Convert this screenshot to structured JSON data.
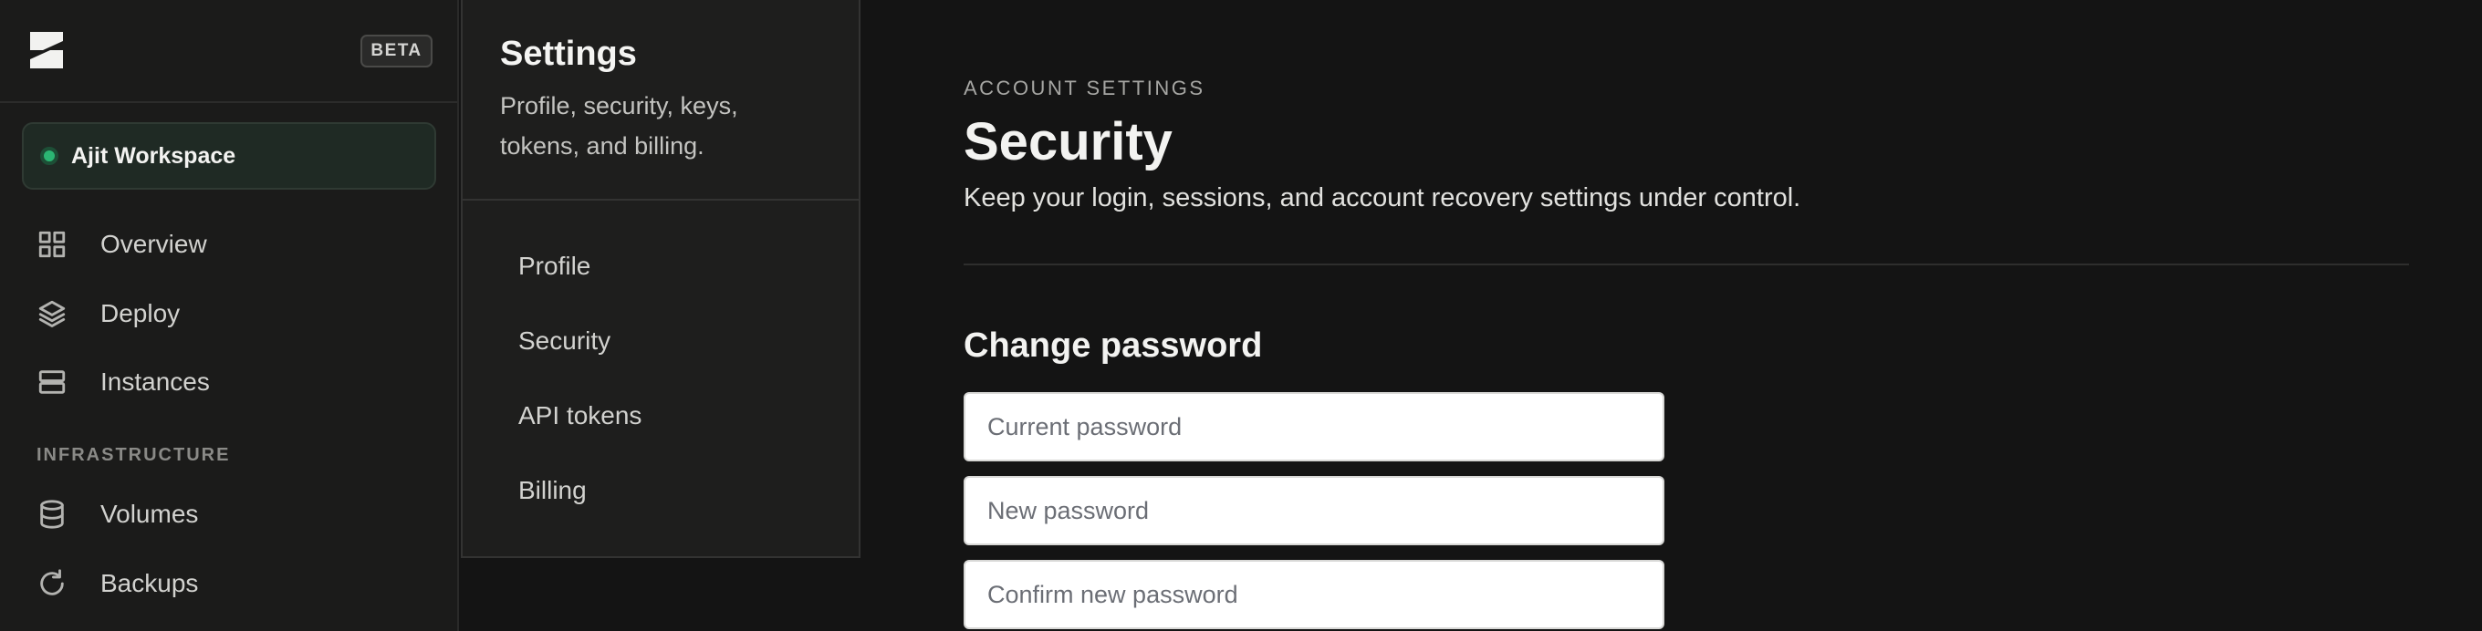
{
  "sidebar": {
    "beta_label": "BETA",
    "workspace": {
      "name": "Ajit Workspace",
      "status_color": "#2bb673"
    },
    "nav": [
      {
        "label": "Overview",
        "icon": "grid-icon"
      },
      {
        "label": "Deploy",
        "icon": "layers-icon"
      },
      {
        "label": "Instances",
        "icon": "server-icon"
      }
    ],
    "section_label": "INFRASTRUCTURE",
    "infra_nav": [
      {
        "label": "Volumes",
        "icon": "database-icon"
      },
      {
        "label": "Backups",
        "icon": "refresh-icon"
      }
    ]
  },
  "settings_panel": {
    "title": "Settings",
    "subtitle": "Profile, security, keys, tokens, and billing.",
    "links": [
      "Profile",
      "Security",
      "API tokens",
      "Billing"
    ]
  },
  "main": {
    "eyebrow": "ACCOUNT SETTINGS",
    "title": "Security",
    "description": "Keep your login, sessions, and account recovery settings under control.",
    "change_password": {
      "title": "Change password",
      "current_placeholder": "Current password",
      "new_placeholder": "New password",
      "confirm_placeholder": "Confirm new password"
    }
  }
}
